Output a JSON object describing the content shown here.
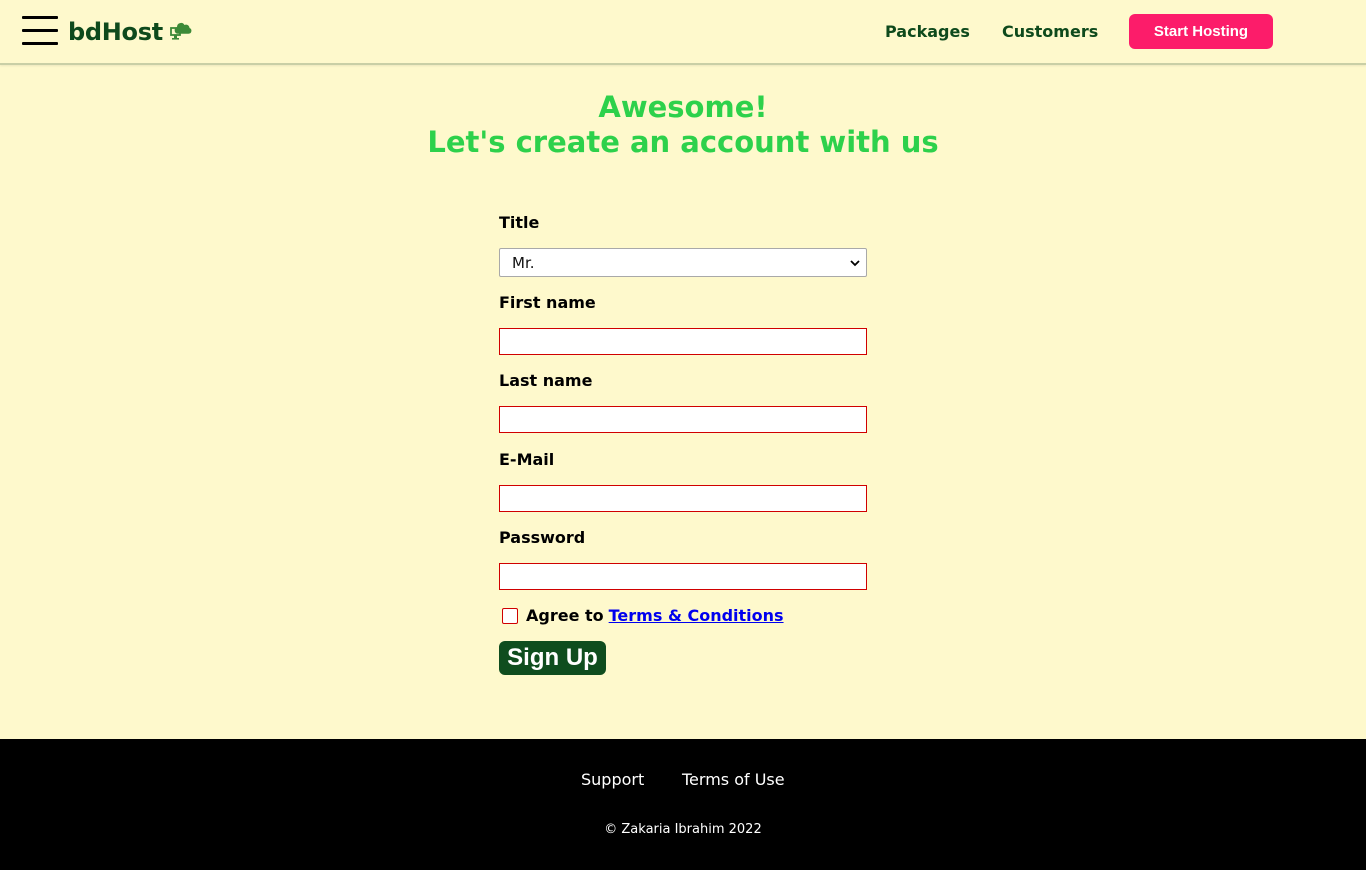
{
  "header": {
    "logo_text": "bdHost",
    "nav": [
      {
        "label": "Packages"
      },
      {
        "label": "Customers"
      }
    ],
    "cta_label": "Start Hosting",
    "logo_icon": "cloud-computer-icon",
    "menu_icon": "hamburger-menu-icon"
  },
  "main": {
    "heading_line1": "Awesome!",
    "heading_line2": "Let's create an account with us",
    "form": {
      "title_label": "Title",
      "title_value": "Mr.",
      "first_name_label": "First name",
      "first_name_value": "",
      "last_name_label": "Last name",
      "last_name_value": "",
      "email_label": "E-Mail",
      "email_value": "",
      "password_label": "Password",
      "password_value": "",
      "agree_label": "Agree to",
      "terms_link": "Terms & Conditions",
      "agree_checked": false,
      "submit_label": "Sign Up"
    }
  },
  "footer": {
    "links": [
      {
        "label": "Support"
      },
      {
        "label": "Terms of Use"
      }
    ],
    "copyright": "© Zakaria Ibrahim 2022"
  },
  "colors": {
    "background": "#fef9cc",
    "brand_green": "#0e4a1c",
    "heading_green": "#2dd14b",
    "cta_pink": "#fc1c6a",
    "invalid_red": "#d00000",
    "link_blue": "#0000ee",
    "footer_bg": "#000000"
  }
}
